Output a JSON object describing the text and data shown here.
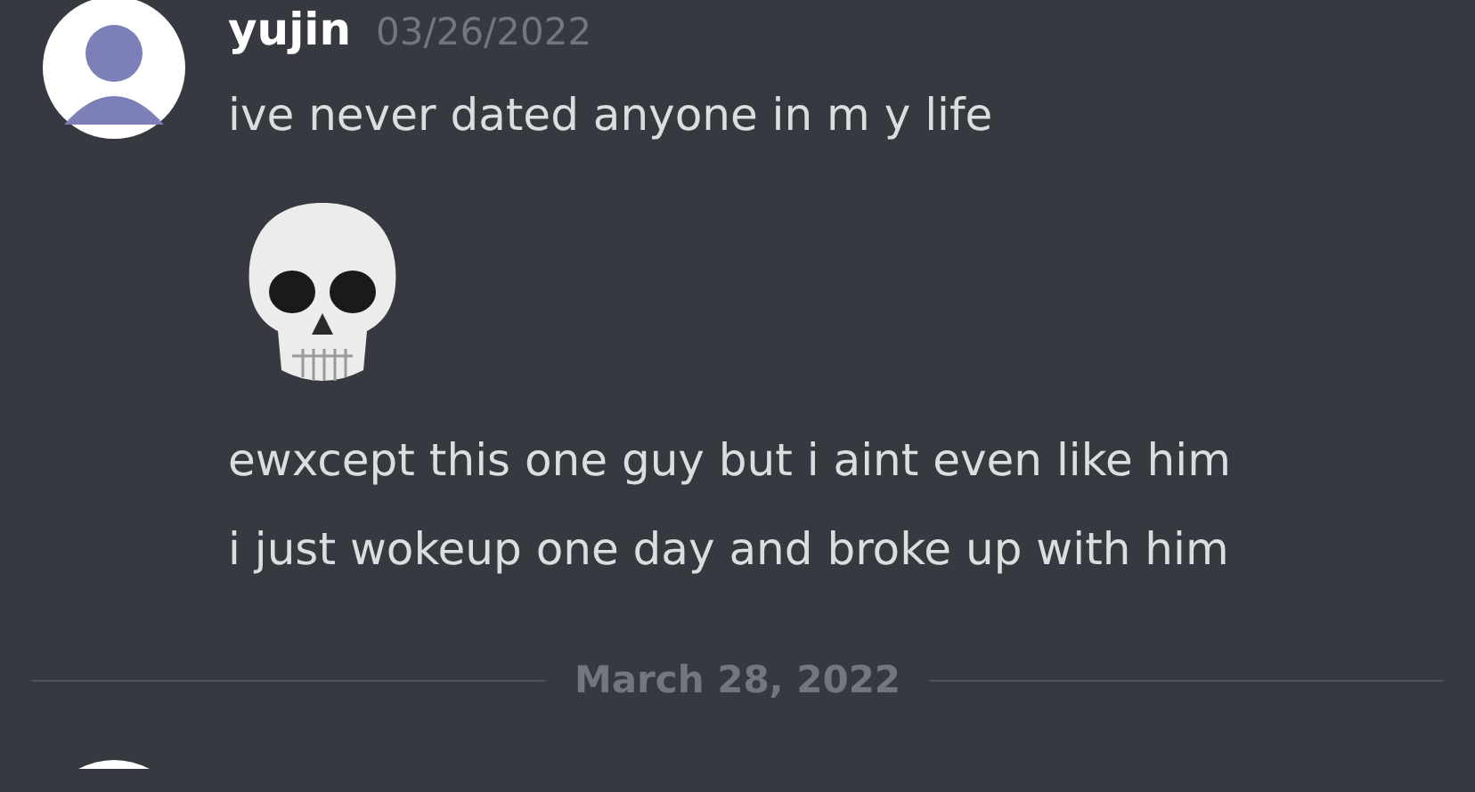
{
  "messages": [
    {
      "author": "yujin",
      "timestamp": "03/26/2022",
      "lines": [
        {
          "kind": "text",
          "text": "ive never dated anyone in m y life"
        },
        {
          "kind": "emoji"
        },
        {
          "kind": "text",
          "text": "ewxcept this one guy but i aint even like him"
        },
        {
          "kind": "text",
          "text": "i just wokeup one day and broke up with him"
        }
      ]
    }
  ],
  "date_divider": "March 28, 2022"
}
